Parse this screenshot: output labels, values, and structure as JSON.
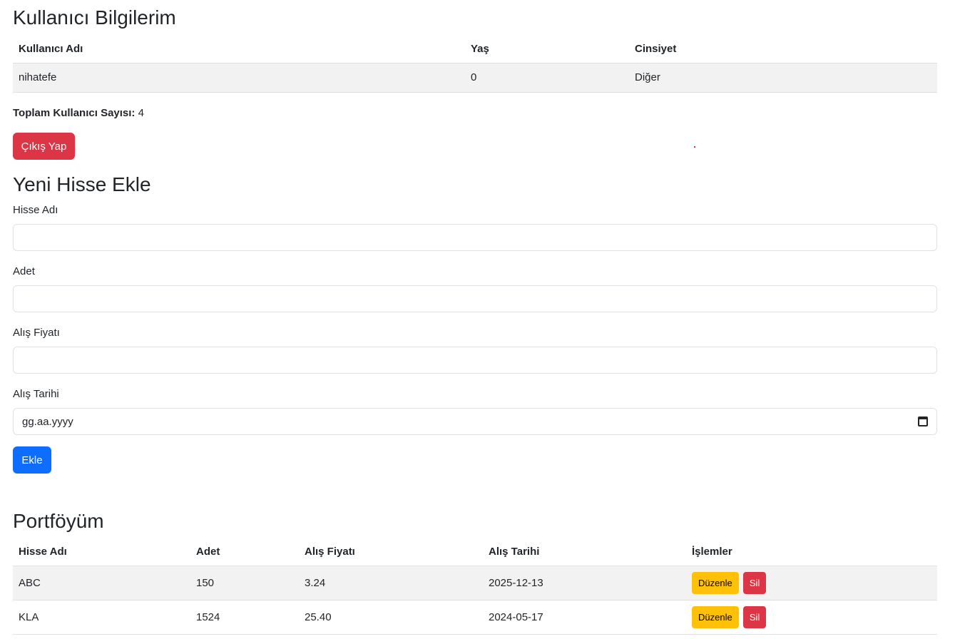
{
  "user_section": {
    "title": "Kullanıcı Bilgilerim",
    "columns": [
      "Kullanıcı Adı",
      "Yaş",
      "Cinsiyet"
    ],
    "row": {
      "username": "nihatefe",
      "age": "0",
      "gender": "Diğer"
    },
    "total_label": "Toplam Kullanıcı Sayısı:",
    "total_value": "4",
    "logout_label": "Çıkış Yap"
  },
  "add_section": {
    "title": "Yeni Hisse Ekle",
    "fields": [
      {
        "label": "Hisse Adı",
        "value": ""
      },
      {
        "label": "Adet",
        "value": ""
      },
      {
        "label": "Alış Fiyatı",
        "value": ""
      },
      {
        "label": "Alış Tarihi",
        "placeholder": "gg.aa.yyyy"
      }
    ],
    "submit_label": "Ekle"
  },
  "portfolio": {
    "title": "Portföyüm",
    "columns": [
      "Hisse Adı",
      "Adet",
      "Alış Fiyatı",
      "Alış Tarihi",
      "İşlemler"
    ],
    "rows": [
      {
        "name": "ABC",
        "qty": "150",
        "price": "3.24",
        "date": "2025-12-13",
        "edit": "Düzenle",
        "delete": "Sil"
      },
      {
        "name": "KLA",
        "qty": "1524",
        "price": "25.40",
        "date": "2024-05-17",
        "edit": "Düzenle",
        "delete": "Sil"
      }
    ]
  },
  "colors": {
    "danger": "#dc3545",
    "primary": "#0d6efd",
    "warning": "#ffc107",
    "stripe": "#f2f2f2"
  },
  "icons": {
    "date": "calendar-icon"
  }
}
